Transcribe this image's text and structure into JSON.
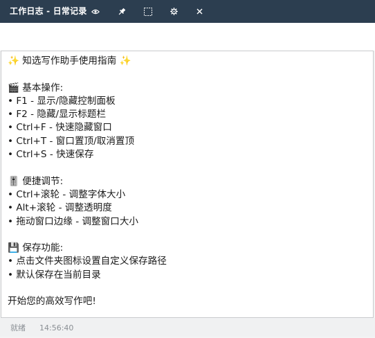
{
  "window": {
    "title": "工作日志 - 日常记录"
  },
  "titlebar_buttons": [
    {
      "name": "visibility-toggle",
      "icon": "eye-icon"
    },
    {
      "name": "pin",
      "icon": "pin-icon"
    },
    {
      "name": "title-bar-toggle",
      "icon": "square-dashed-icon"
    },
    {
      "name": "settings",
      "icon": "gear-icon"
    },
    {
      "name": "close",
      "icon": "close-icon"
    }
  ],
  "editor": {
    "content": "✨ 知选写作助手使用指南 ✨\n\n🎬 基本操作:\n• F1 - 显示/隐藏控制面板\n• F2 - 隐藏/显示标题栏\n• Ctrl+F - 快速隐藏窗口\n• Ctrl+T - 窗口置顶/取消置顶\n• Ctrl+S - 快速保存\n\n🎚️ 便捷调节:\n• Ctrl+滚轮 - 调整字体大小\n• Alt+滚轮 - 调整透明度\n• 拖动窗口边缘 - 调整窗口大小\n\n💾 保存功能:\n• 点击文件夹图标设置自定义保存路径\n• 默认保存在当前目录\n\n开始您的高效写作吧!"
  },
  "status": {
    "text": "就绪",
    "time": "14:56:40"
  },
  "colors": {
    "titlebar": "#2c3e50",
    "status_text": "#8a8f94",
    "editor_border": "#c9cbcd"
  }
}
